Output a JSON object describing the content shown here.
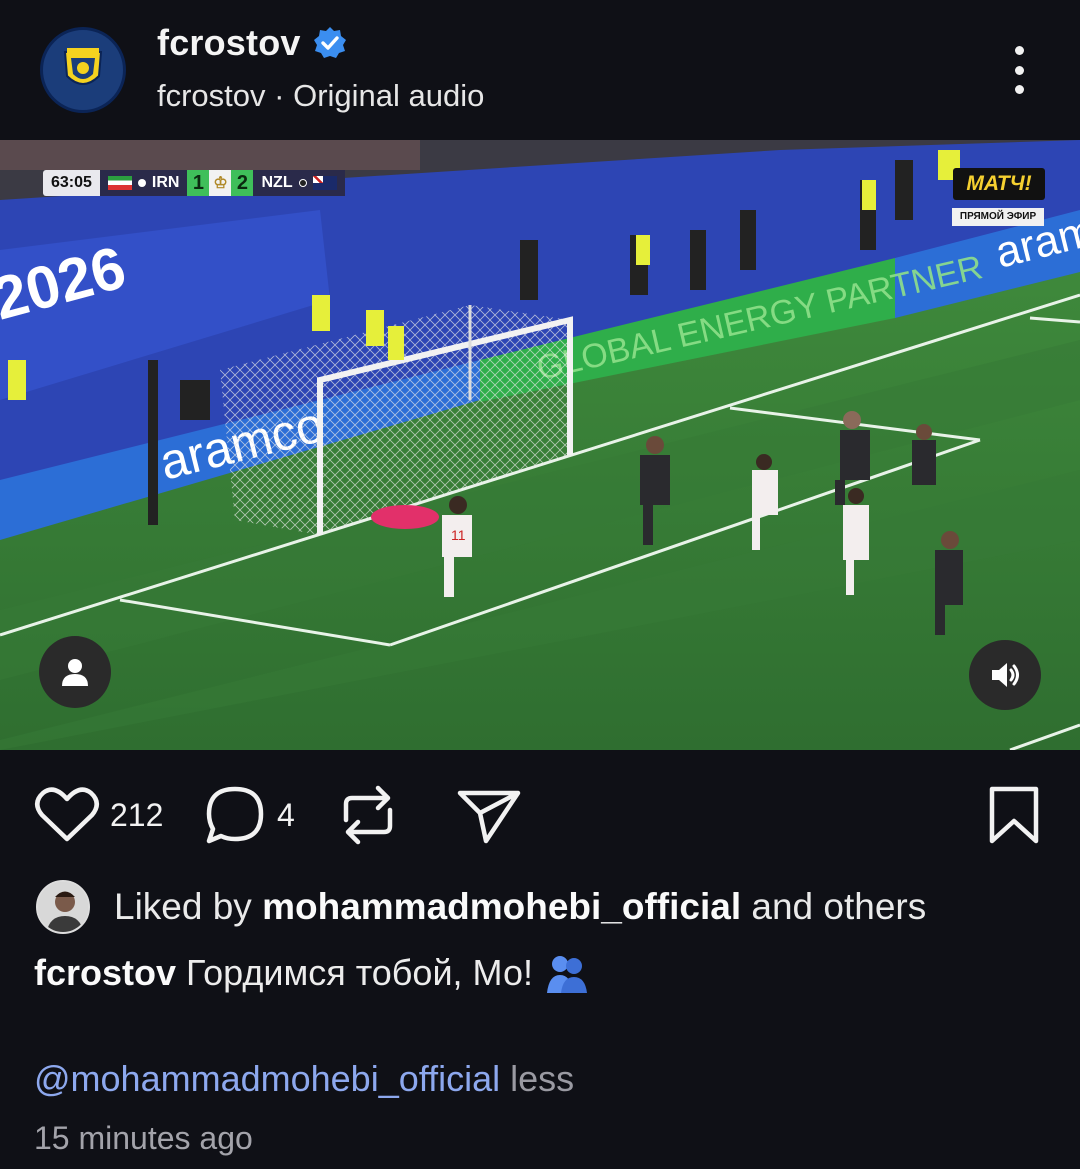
{
  "header": {
    "username": "fcrostov",
    "subline": "fcrostov · Original audio",
    "avatar_icon": "fc-rostov-crest-icon",
    "verified_icon": "verified-badge-icon",
    "more_icon": "more-vertical-icon"
  },
  "video": {
    "scorebug": {
      "clock": "63:05",
      "home_team": "IRN",
      "home_score": "1",
      "away_score": "2",
      "away_team": "NZL"
    },
    "channel_logo": "МАТЧ!",
    "live_label": "ПРЯМОЙ ЭФИР",
    "ad_boards": [
      "2026",
      "aramco",
      "GLOBAL ENERGY PARTNER",
      "aram"
    ],
    "tag_icon": "user-tag-icon",
    "sound_icon": "speaker-icon"
  },
  "actions": {
    "likes": "212",
    "comments": "4",
    "like_icon": "heart-icon",
    "comment_icon": "comment-icon",
    "repost_icon": "repost-icon",
    "share_icon": "send-icon",
    "save_icon": "bookmark-icon"
  },
  "likes_row": {
    "prefix": "Liked by ",
    "user": "mohammadmohebi_official",
    "suffix": " and others"
  },
  "caption": {
    "author": "fcrostov",
    "text": "Гордимся тобой, Мо!"
  },
  "mention": "@mohammadmohebi_official",
  "less": "less",
  "timestamp": "15 minutes ago",
  "colors": {
    "background": "#0f1016",
    "mention": "#8da8ee",
    "verified": "#3b8ef0"
  }
}
